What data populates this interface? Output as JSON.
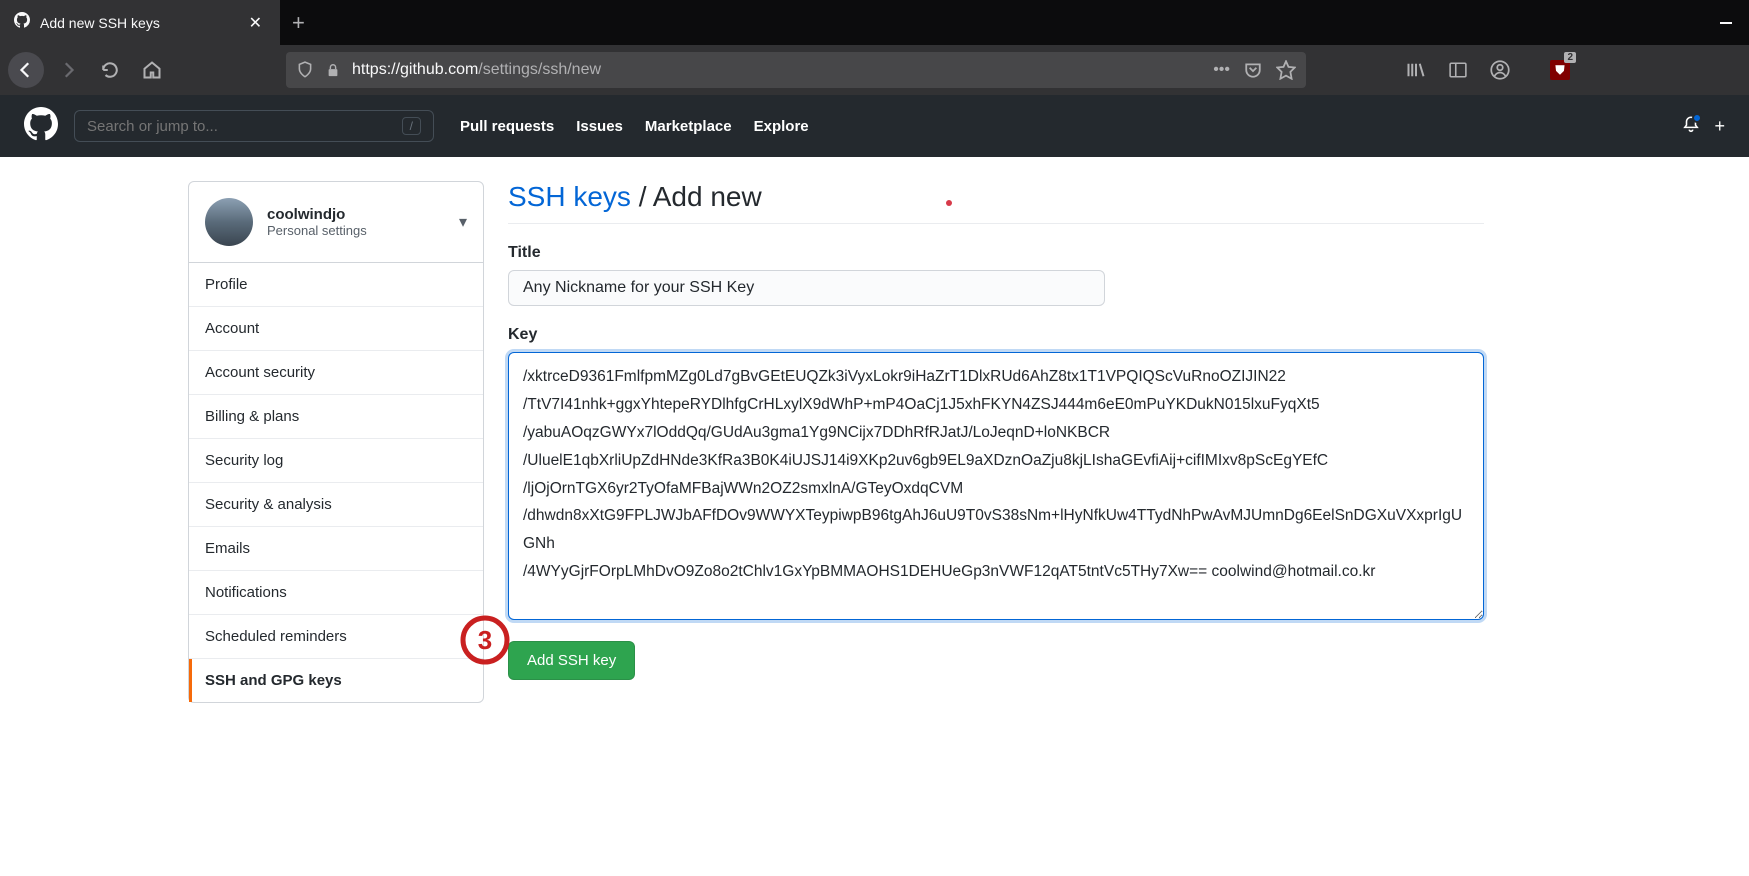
{
  "browser": {
    "tab_title": "Add new SSH keys",
    "url_host": "https://github.com",
    "url_path": "/settings/ssh/new",
    "ublock_count": "2"
  },
  "github": {
    "search_placeholder": "Search or jump to...",
    "nav": {
      "pull": "Pull requests",
      "issues": "Issues",
      "market": "Marketplace",
      "explore": "Explore"
    }
  },
  "sidebar": {
    "username": "coolwindjo",
    "subtitle": "Personal settings",
    "items": [
      "Profile",
      "Account",
      "Account security",
      "Billing & plans",
      "Security log",
      "Security & analysis",
      "Emails",
      "Notifications",
      "Scheduled reminders",
      "SSH and GPG keys"
    ]
  },
  "page": {
    "breadcrumb_link": "SSH keys",
    "breadcrumb_sep": " / ",
    "breadcrumb_current": "Add new",
    "title_label": "Title",
    "title_value": "Any Nickname for your SSH Key",
    "key_label": "Key",
    "key_value": "/xktrceD9361FmlfpmMZg0Ld7gBvGEtEUQZk3iVyxLokr9iHaZrT1DlxRUd6AhZ8tx1T1VPQIQScVuRnoOZIJIN22\n/TtV7I41nhk+ggxYhtepeRYDlhfgCrHLxylX9dWhP+mP4OaCj1J5xhFKYN4ZSJ444m6eE0mPuYKDukN015lxuFyqXt5\n/yabuAOqzGWYx7lOddQq/GUdAu3gma1Yg9NCijx7DDhRfRJatJ/LoJeqnD+loNKBCR\n/UluelE1qbXrliUpZdHNde3KfRa3B0K4iUJSJ14i9XKp2uv6gb9EL9aXDznOaZju8kjLIshaGEvfiAij+cifIMIxv8pScEgYEfC\n/ljOjOrnTGX6yr2TyOfaMFBajWWn2OZ2smxlnA/GTeyOxdqCVM\n/dhwdn8xXtG9FPLJWJbAFfDOv9WWYXTeypiwpB96tgAhJ6uU9T0vS38sNm+lHyNfkUw4TTydNhPwAvMJUmnDg6EelSnDGXuVXxprIgUGNh\n/4WYyGjrFOrpLMhDvO9Zo8o2tChlv1GxYpBMMAOHS1DEHUeGp3nVWF12qAT5tntVc5THy7Xw== coolwind@hotmail.co.kr",
    "submit_label": "Add SSH key"
  }
}
